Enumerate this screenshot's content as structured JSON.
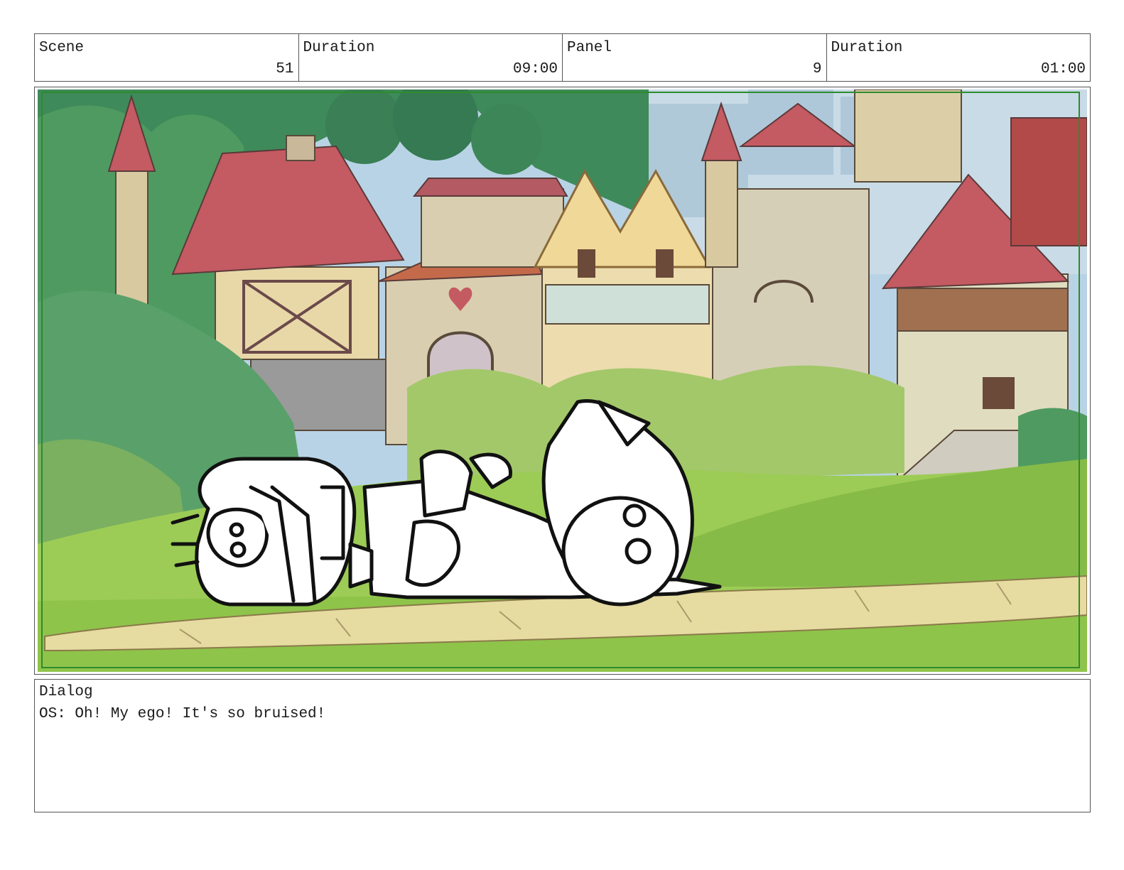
{
  "header": {
    "scene": {
      "label": "Scene",
      "value": "51"
    },
    "scene_duration": {
      "label": "Duration",
      "value": "09:00"
    },
    "panel": {
      "label": "Panel",
      "value": "9"
    },
    "panel_duration": {
      "label": "Duration",
      "value": "01:00"
    }
  },
  "dialog": {
    "label": "Dialog",
    "text": "OS: Oh! My ego! It's so bruised!"
  },
  "colors": {
    "sky": "#b9d3e6",
    "foliage_dark": "#3f8a5a",
    "foliage_light": "#9cc46a",
    "grass": "#8fc44a",
    "roof": "#c45a62",
    "wall": "#e8d8a8",
    "path": "#e6dba0",
    "safe_frame": "#2e8b2e"
  }
}
